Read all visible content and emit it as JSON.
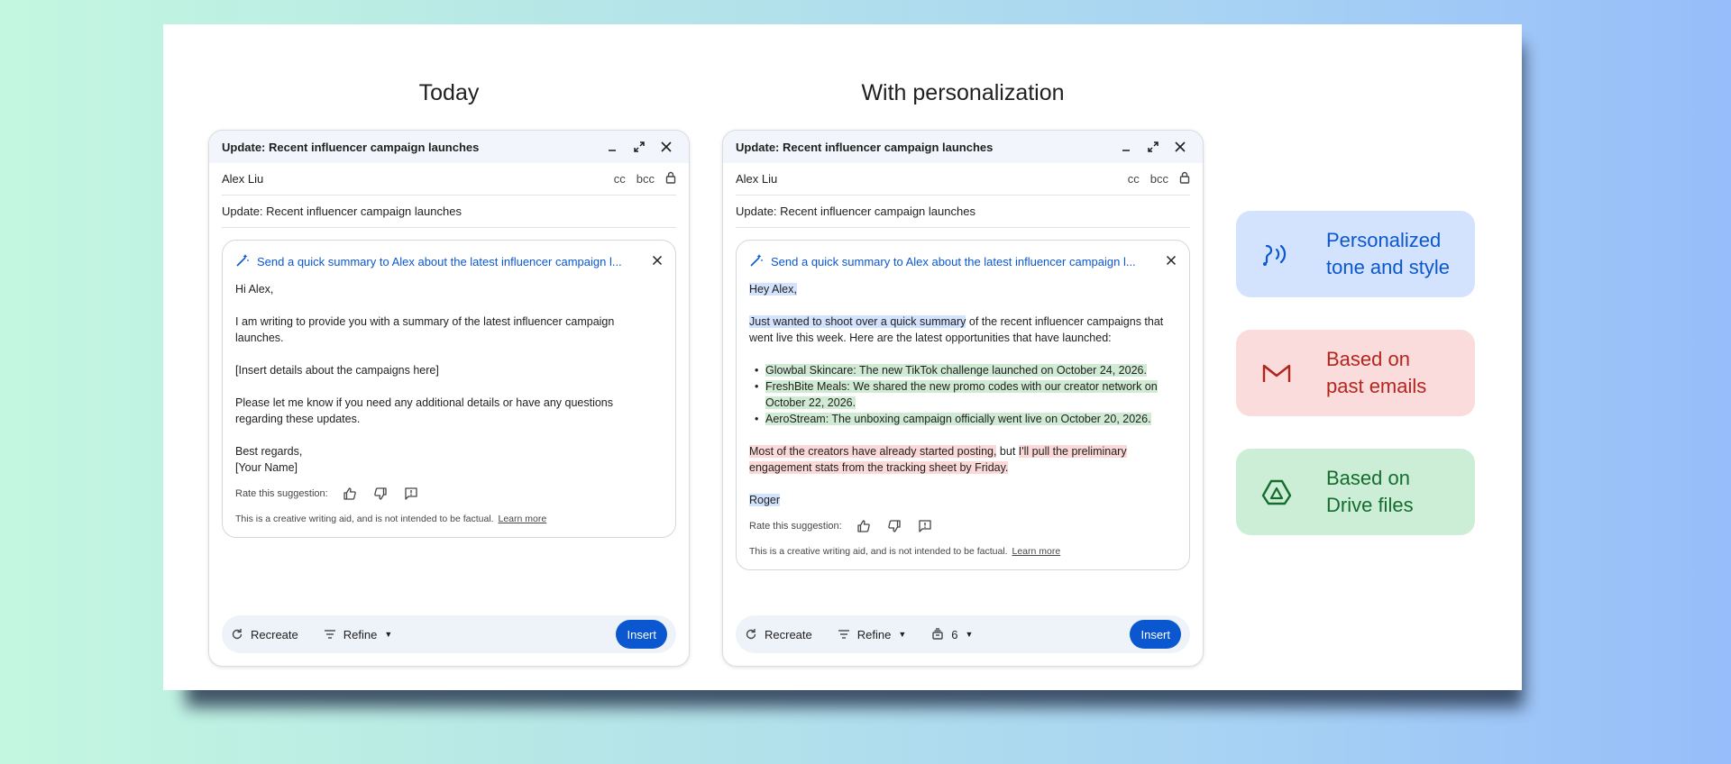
{
  "columns": {
    "left_title": "Today",
    "right_title": "With personalization"
  },
  "left": {
    "header_title": "Update: Recent influencer campaign launches",
    "to": "Alex Liu",
    "cc": "cc",
    "bcc": "bcc",
    "subject": "Update: Recent influencer campaign launches",
    "prompt": "Send a quick summary to Alex about the latest influencer campaign l...",
    "body": {
      "greeting": "Hi Alex,",
      "p1": "I am writing to provide you with a summary of the latest influencer campaign launches.",
      "p2": "[Insert details about the campaigns here]",
      "p3": "Please let me know if you need any additional details or have any questions regarding these updates.",
      "signoff": "Best regards,",
      "name": "[Your Name]"
    },
    "rate_label": "Rate this suggestion:",
    "disclaimer": "This is a creative writing aid, and is not intended to be factual.",
    "learn_more": "Learn more",
    "toolbar": {
      "recreate": "Recreate",
      "refine": "Refine",
      "insert": "Insert"
    }
  },
  "right": {
    "header_title": "Update: Recent influencer campaign launches",
    "to": "Alex Liu",
    "cc": "cc",
    "bcc": "bcc",
    "subject": "Update: Recent influencer campaign launches",
    "prompt": "Send a quick summary to Alex about the latest influencer campaign l...",
    "body": {
      "greeting": "Hey Alex,",
      "p1_highlight": "Just wanted to shoot over a quick summary",
      "p1_rest": " of the recent influencer campaigns that went live this week. Here are the latest opportunities that have launched:",
      "bullets": [
        "Glowbal Skincare: The new TikTok challenge launched on October 24, 2026.",
        "FreshBite Meals: We shared the new promo codes with our creator network on October 22, 2026.",
        "AeroStream: The unboxing campaign officially went live on October 20, 2026."
      ],
      "p2_highlight_a": "Most of the creators have already started posting,",
      "p2_plain": " but ",
      "p2_highlight_b": "I'll pull the preliminary engagement stats from the tracking sheet by Friday.",
      "name": "Roger"
    },
    "rate_label": "Rate this suggestion:",
    "disclaimer": "This is a creative writing aid, and is not intended to be factual.",
    "learn_more": "Learn more",
    "toolbar": {
      "recreate": "Recreate",
      "refine": "Refine",
      "count": "6",
      "insert": "Insert"
    }
  },
  "features": [
    {
      "line1": "Personalized",
      "line2": "tone and style",
      "icon": "voice-wave-icon",
      "bg": "#d3e3fd",
      "fg": "#0b57d0"
    },
    {
      "line1": "Based on",
      "line2": "past emails",
      "icon": "gmail-icon",
      "bg": "#fbdcdc",
      "fg": "#b3261e"
    },
    {
      "line1": "Based on",
      "line2": "Drive files",
      "icon": "drive-icon",
      "bg": "#cdeed6",
      "fg": "#146c2e"
    }
  ],
  "colors": {
    "accent": "#0b57d0",
    "highlight_blue": "#d3e3fd",
    "highlight_green": "#d0ead4",
    "highlight_red": "#fbd9d9"
  }
}
